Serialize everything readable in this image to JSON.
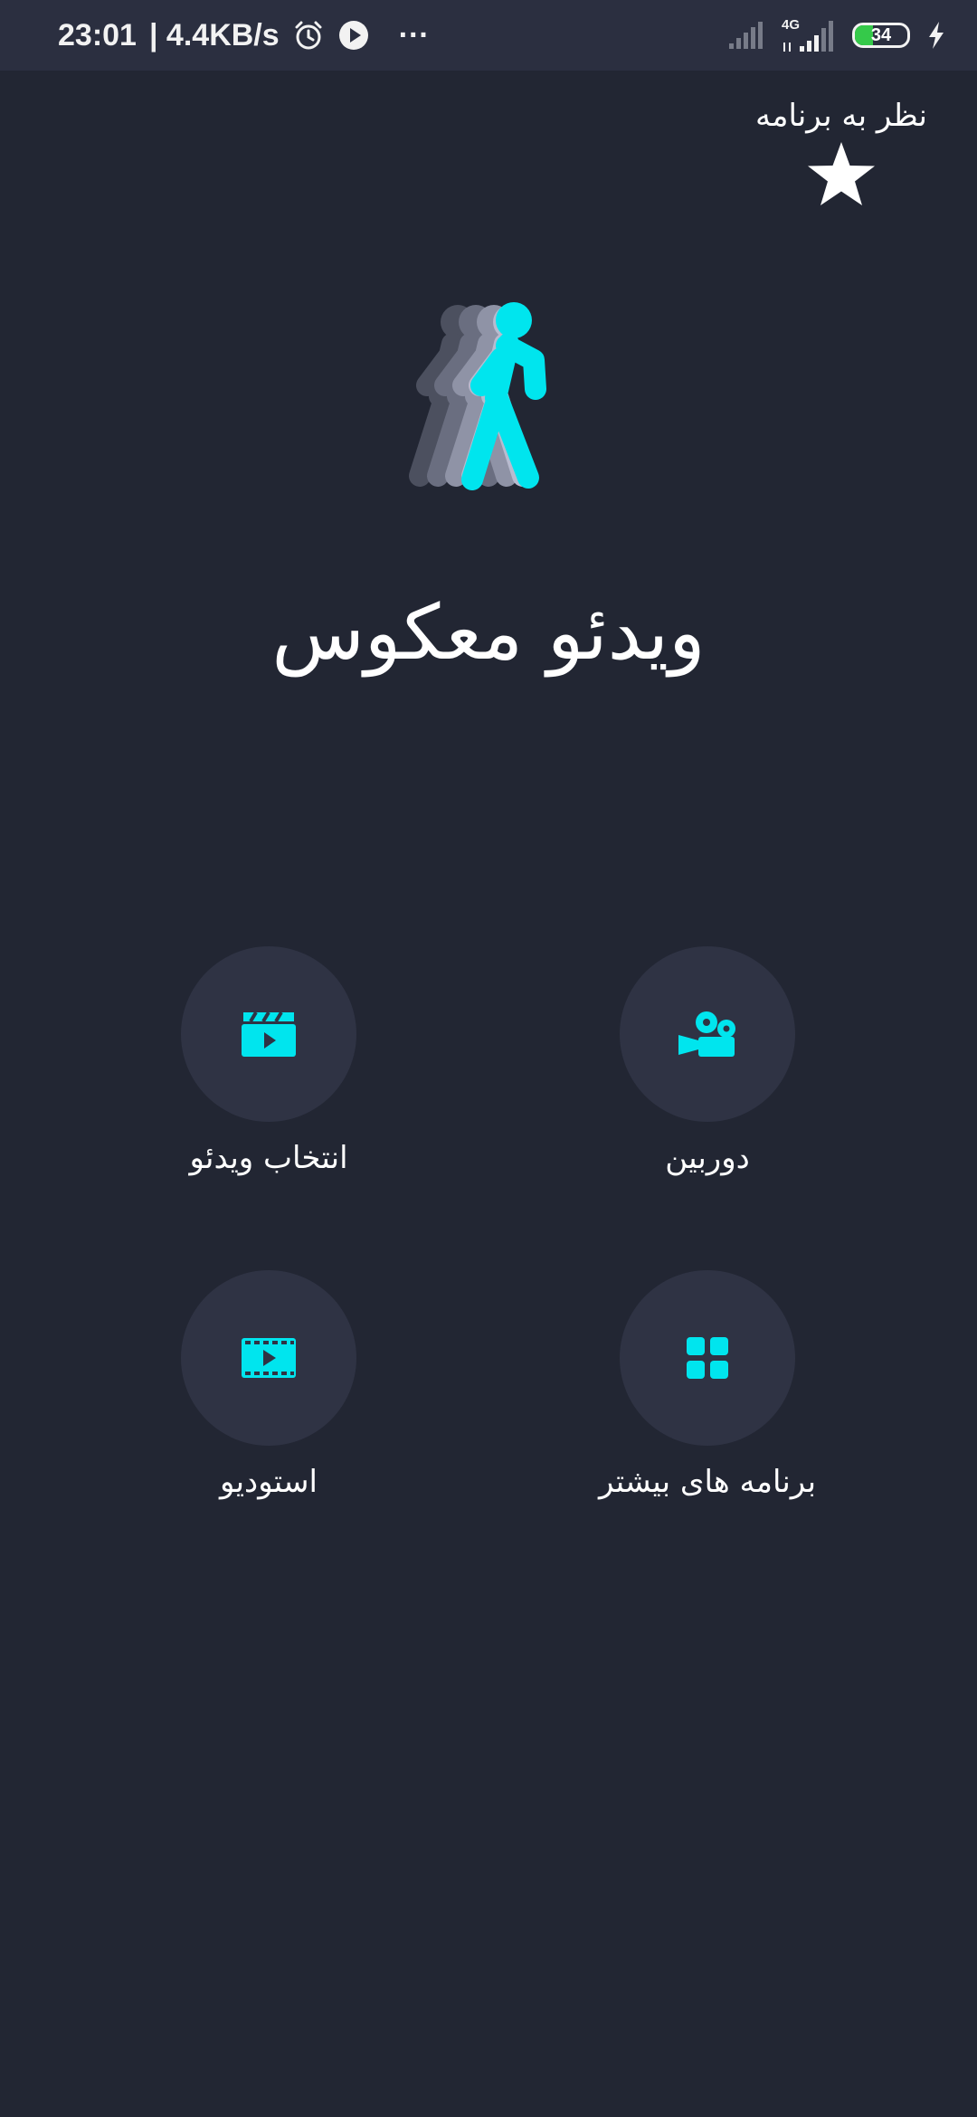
{
  "status_bar": {
    "time": "23:01",
    "network_speed": "| 4.4KB/s",
    "more": "···",
    "network_type": "4G",
    "battery_level": "34",
    "battery_fraction": 0.34,
    "icons": [
      "alarm-icon",
      "media-play-icon",
      "signal-icon",
      "signal-4g-icon",
      "battery-icon",
      "charging-icon"
    ]
  },
  "rate_app": {
    "label": "نظر به برنامه",
    "icon": "star-icon"
  },
  "app": {
    "title": "ویدئو معکوس",
    "logo_icon": "walking-person-icon",
    "accent_color": "#00e5ee",
    "background_color": "#222633",
    "tile_color": "#2f3344"
  },
  "menu": {
    "select_video": {
      "label": "انتخاب ویدئو",
      "icon": "clapperboard-icon"
    },
    "camera": {
      "label": "دوربین",
      "icon": "video-camera-icon"
    },
    "studio": {
      "label": "استودیو",
      "icon": "film-strip-icon"
    },
    "more_apps": {
      "label": "برنامه های بیشتر",
      "icon": "apps-grid-icon"
    }
  }
}
